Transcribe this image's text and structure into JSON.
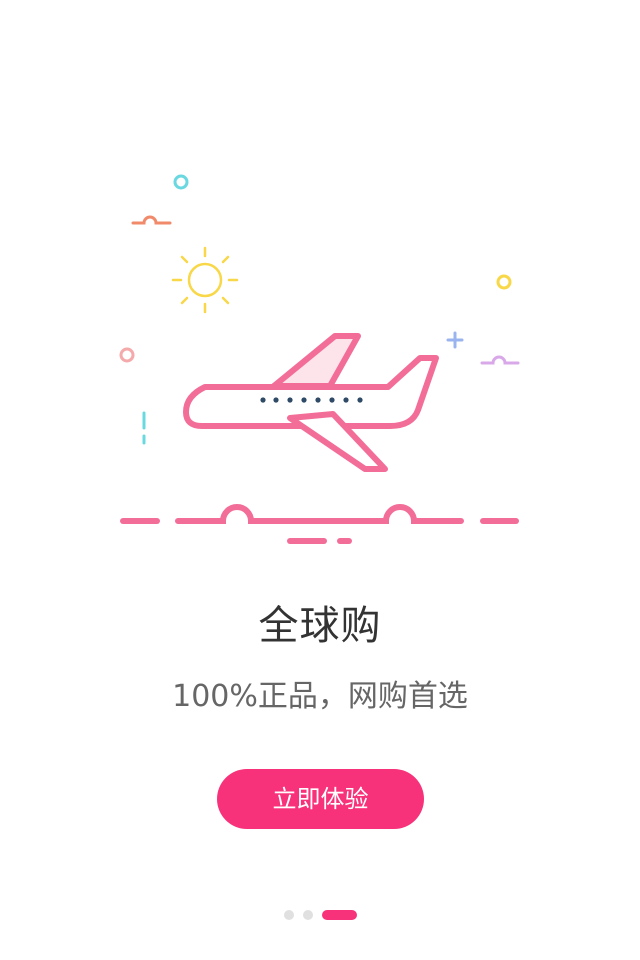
{
  "onboarding": {
    "title": "全球购",
    "subtitle": "100%正品，网购首选",
    "cta_label": "立即体验"
  },
  "pager": {
    "total_pages": 3,
    "current_page": 3
  },
  "colors": {
    "accent": "#f8327a",
    "plane_stroke": "#f36d99",
    "plane_wing_fill": "#fde4ea",
    "title_text": "#333333",
    "subtitle_text": "#666666",
    "dot_inactive": "#e0e0e0",
    "sun": "#f8d848",
    "cloud_orange": "#f08a6a",
    "circle_teal": "#6ad8e0",
    "circle_yellow": "#f8d848",
    "circle_pink": "#f4aaaa",
    "sparkle_blue": "#9ab4f0",
    "cloud_purple": "#d8a8e8",
    "window_dots": "#2e4a66"
  },
  "icons": {
    "plane": "airplane-icon",
    "sun": "sun-icon"
  }
}
